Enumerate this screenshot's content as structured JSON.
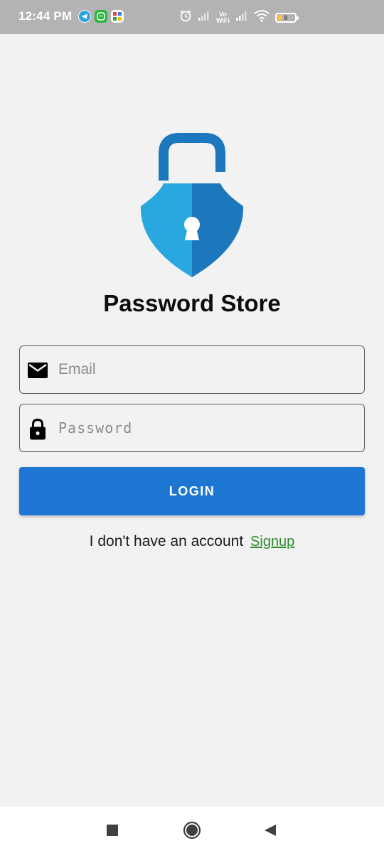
{
  "status_bar": {
    "time": "12:44 PM",
    "notification_icons": [
      "telegram-icon",
      "app-notification-icon",
      "grid-app-icon"
    ],
    "system_icons": [
      "alarm-icon",
      "signal-icon",
      "volte-wifi-icon",
      "signal-icon",
      "wifi-icon",
      "battery-icon"
    ],
    "volte_top": "Vo",
    "volte_bottom": "WiFi",
    "battery_level": "8"
  },
  "app": {
    "title": "Password Store",
    "logo": "shield-padlock-icon",
    "colors": {
      "shield_light": "#29a8e0",
      "shield_dark": "#1d77bd",
      "shackle": "#1d77bd",
      "button": "#1e76d3",
      "link": "#2e8b2e"
    }
  },
  "form": {
    "email": {
      "value": "",
      "placeholder": "Email",
      "icon": "mail-icon"
    },
    "password": {
      "value": "",
      "placeholder": "Password",
      "icon": "lock-icon"
    },
    "login_label": "LOGIN"
  },
  "signup": {
    "prompt": "I don't have an account",
    "link_label": "Signup"
  },
  "nav_bar": {
    "buttons": [
      "recents-icon",
      "home-icon",
      "back-icon"
    ]
  }
}
